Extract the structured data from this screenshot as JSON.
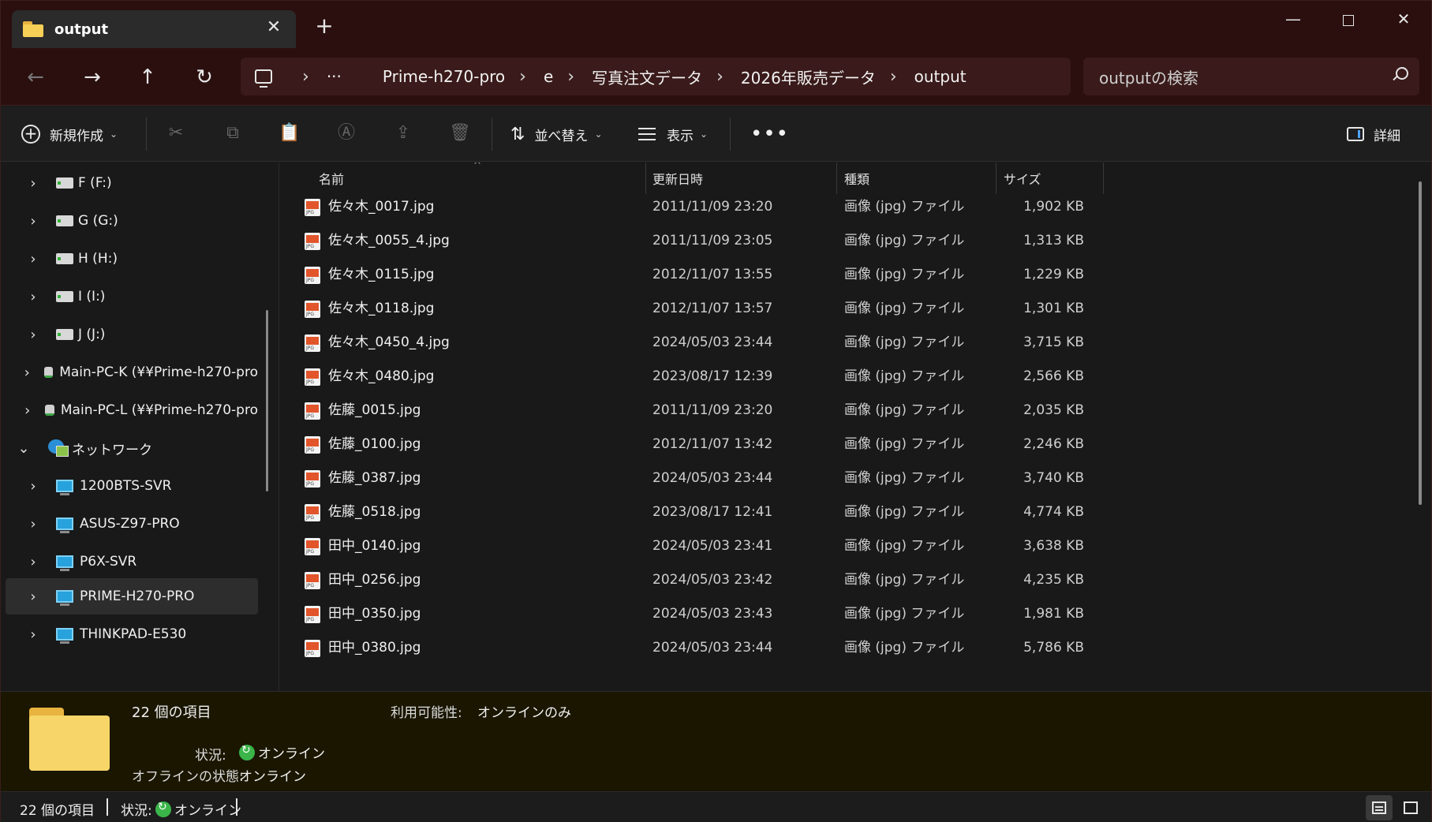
{
  "titlebar": {
    "tab_title": "output",
    "close_glyph": "✕",
    "new_tab_glyph": "+",
    "minimize_glyph": "—",
    "close_window_glyph": "✕"
  },
  "address": {
    "breadcrumbs": [
      "Prime-h270-pro",
      "e",
      "写真注文データ",
      "2026年販売データ",
      "output"
    ],
    "ellipsis": "···",
    "search_placeholder": "outputの検索"
  },
  "commandbar": {
    "new_label": "新規作成",
    "sort_label": "並べ替え",
    "view_label": "表示",
    "more_label": "•••",
    "details_label": "詳細"
  },
  "sidebar": {
    "items": [
      {
        "label": "F (F:)",
        "icon": "drive-icon"
      },
      {
        "label": "G (G:)",
        "icon": "drive-icon"
      },
      {
        "label": "H (H:)",
        "icon": "drive-icon"
      },
      {
        "label": "I (I:)",
        "icon": "drive-icon"
      },
      {
        "label": "J (J:)",
        "icon": "drive-icon"
      },
      {
        "label": "Main-PC-K (¥¥Prime-h270-pro",
        "icon": "network-drive-icon"
      },
      {
        "label": "Main-PC-L (¥¥Prime-h270-pro",
        "icon": "network-drive-icon"
      },
      {
        "label": "ネットワーク",
        "icon": "network-icon"
      },
      {
        "label": "1200BTS-SVR",
        "icon": "computer-icon"
      },
      {
        "label": "ASUS-Z97-PRO",
        "icon": "computer-icon"
      },
      {
        "label": "P6X-SVR",
        "icon": "computer-icon"
      },
      {
        "label": "PRIME-H270-PRO",
        "icon": "computer-icon"
      },
      {
        "label": "THINKPAD-E530",
        "icon": "computer-icon"
      }
    ]
  },
  "filelist": {
    "columns": {
      "name": "名前",
      "date": "更新日時",
      "type": "種類",
      "size": "サイズ"
    },
    "rows": [
      {
        "name": "佐々木_0017.jpg",
        "date": "2011/11/09 23:20",
        "type": "画像 (jpg) ファイル",
        "size": "1,902 KB"
      },
      {
        "name": "佐々木_0055_4.jpg",
        "date": "2011/11/09 23:05",
        "type": "画像 (jpg) ファイル",
        "size": "1,313 KB"
      },
      {
        "name": "佐々木_0115.jpg",
        "date": "2012/11/07 13:55",
        "type": "画像 (jpg) ファイル",
        "size": "1,229 KB"
      },
      {
        "name": "佐々木_0118.jpg",
        "date": "2012/11/07 13:57",
        "type": "画像 (jpg) ファイル",
        "size": "1,301 KB"
      },
      {
        "name": "佐々木_0450_4.jpg",
        "date": "2024/05/03 23:44",
        "type": "画像 (jpg) ファイル",
        "size": "3,715 KB"
      },
      {
        "name": "佐々木_0480.jpg",
        "date": "2023/08/17 12:39",
        "type": "画像 (jpg) ファイル",
        "size": "2,566 KB"
      },
      {
        "name": "佐藤_0015.jpg",
        "date": "2011/11/09 23:20",
        "type": "画像 (jpg) ファイル",
        "size": "2,035 KB"
      },
      {
        "name": "佐藤_0100.jpg",
        "date": "2012/11/07 13:42",
        "type": "画像 (jpg) ファイル",
        "size": "2,246 KB"
      },
      {
        "name": "佐藤_0387.jpg",
        "date": "2024/05/03 23:44",
        "type": "画像 (jpg) ファイル",
        "size": "3,740 KB"
      },
      {
        "name": "佐藤_0518.jpg",
        "date": "2023/08/17 12:41",
        "type": "画像 (jpg) ファイル",
        "size": "4,774 KB"
      },
      {
        "name": "田中_0140.jpg",
        "date": "2024/05/03 23:41",
        "type": "画像 (jpg) ファイル",
        "size": "3,638 KB"
      },
      {
        "name": "田中_0256.jpg",
        "date": "2024/05/03 23:42",
        "type": "画像 (jpg) ファイル",
        "size": "4,235 KB"
      },
      {
        "name": "田中_0350.jpg",
        "date": "2024/05/03 23:43",
        "type": "画像 (jpg) ファイル",
        "size": "1,981 KB"
      },
      {
        "name": "田中_0380.jpg",
        "date": "2024/05/03 23:44",
        "type": "画像 (jpg) ファイル",
        "size": "5,786 KB"
      }
    ]
  },
  "details": {
    "item_count": "22 個の項目",
    "availability_label": "利用可能性:",
    "availability_value": "オンラインのみ",
    "status_label": "状況:",
    "status_value": "オンライン",
    "offline_label": "オフラインの状態:",
    "offline_value": "オンライン"
  },
  "statusbar": {
    "item_count": "22 個の項目",
    "status_label": "状況:",
    "status_value": "オンライン"
  },
  "colors": {
    "titlebar_bg": "#2a0f0e",
    "accent_blue": "#4da3ff",
    "online_green": "#3bb54a",
    "folder_yellow": "#f7d568"
  }
}
